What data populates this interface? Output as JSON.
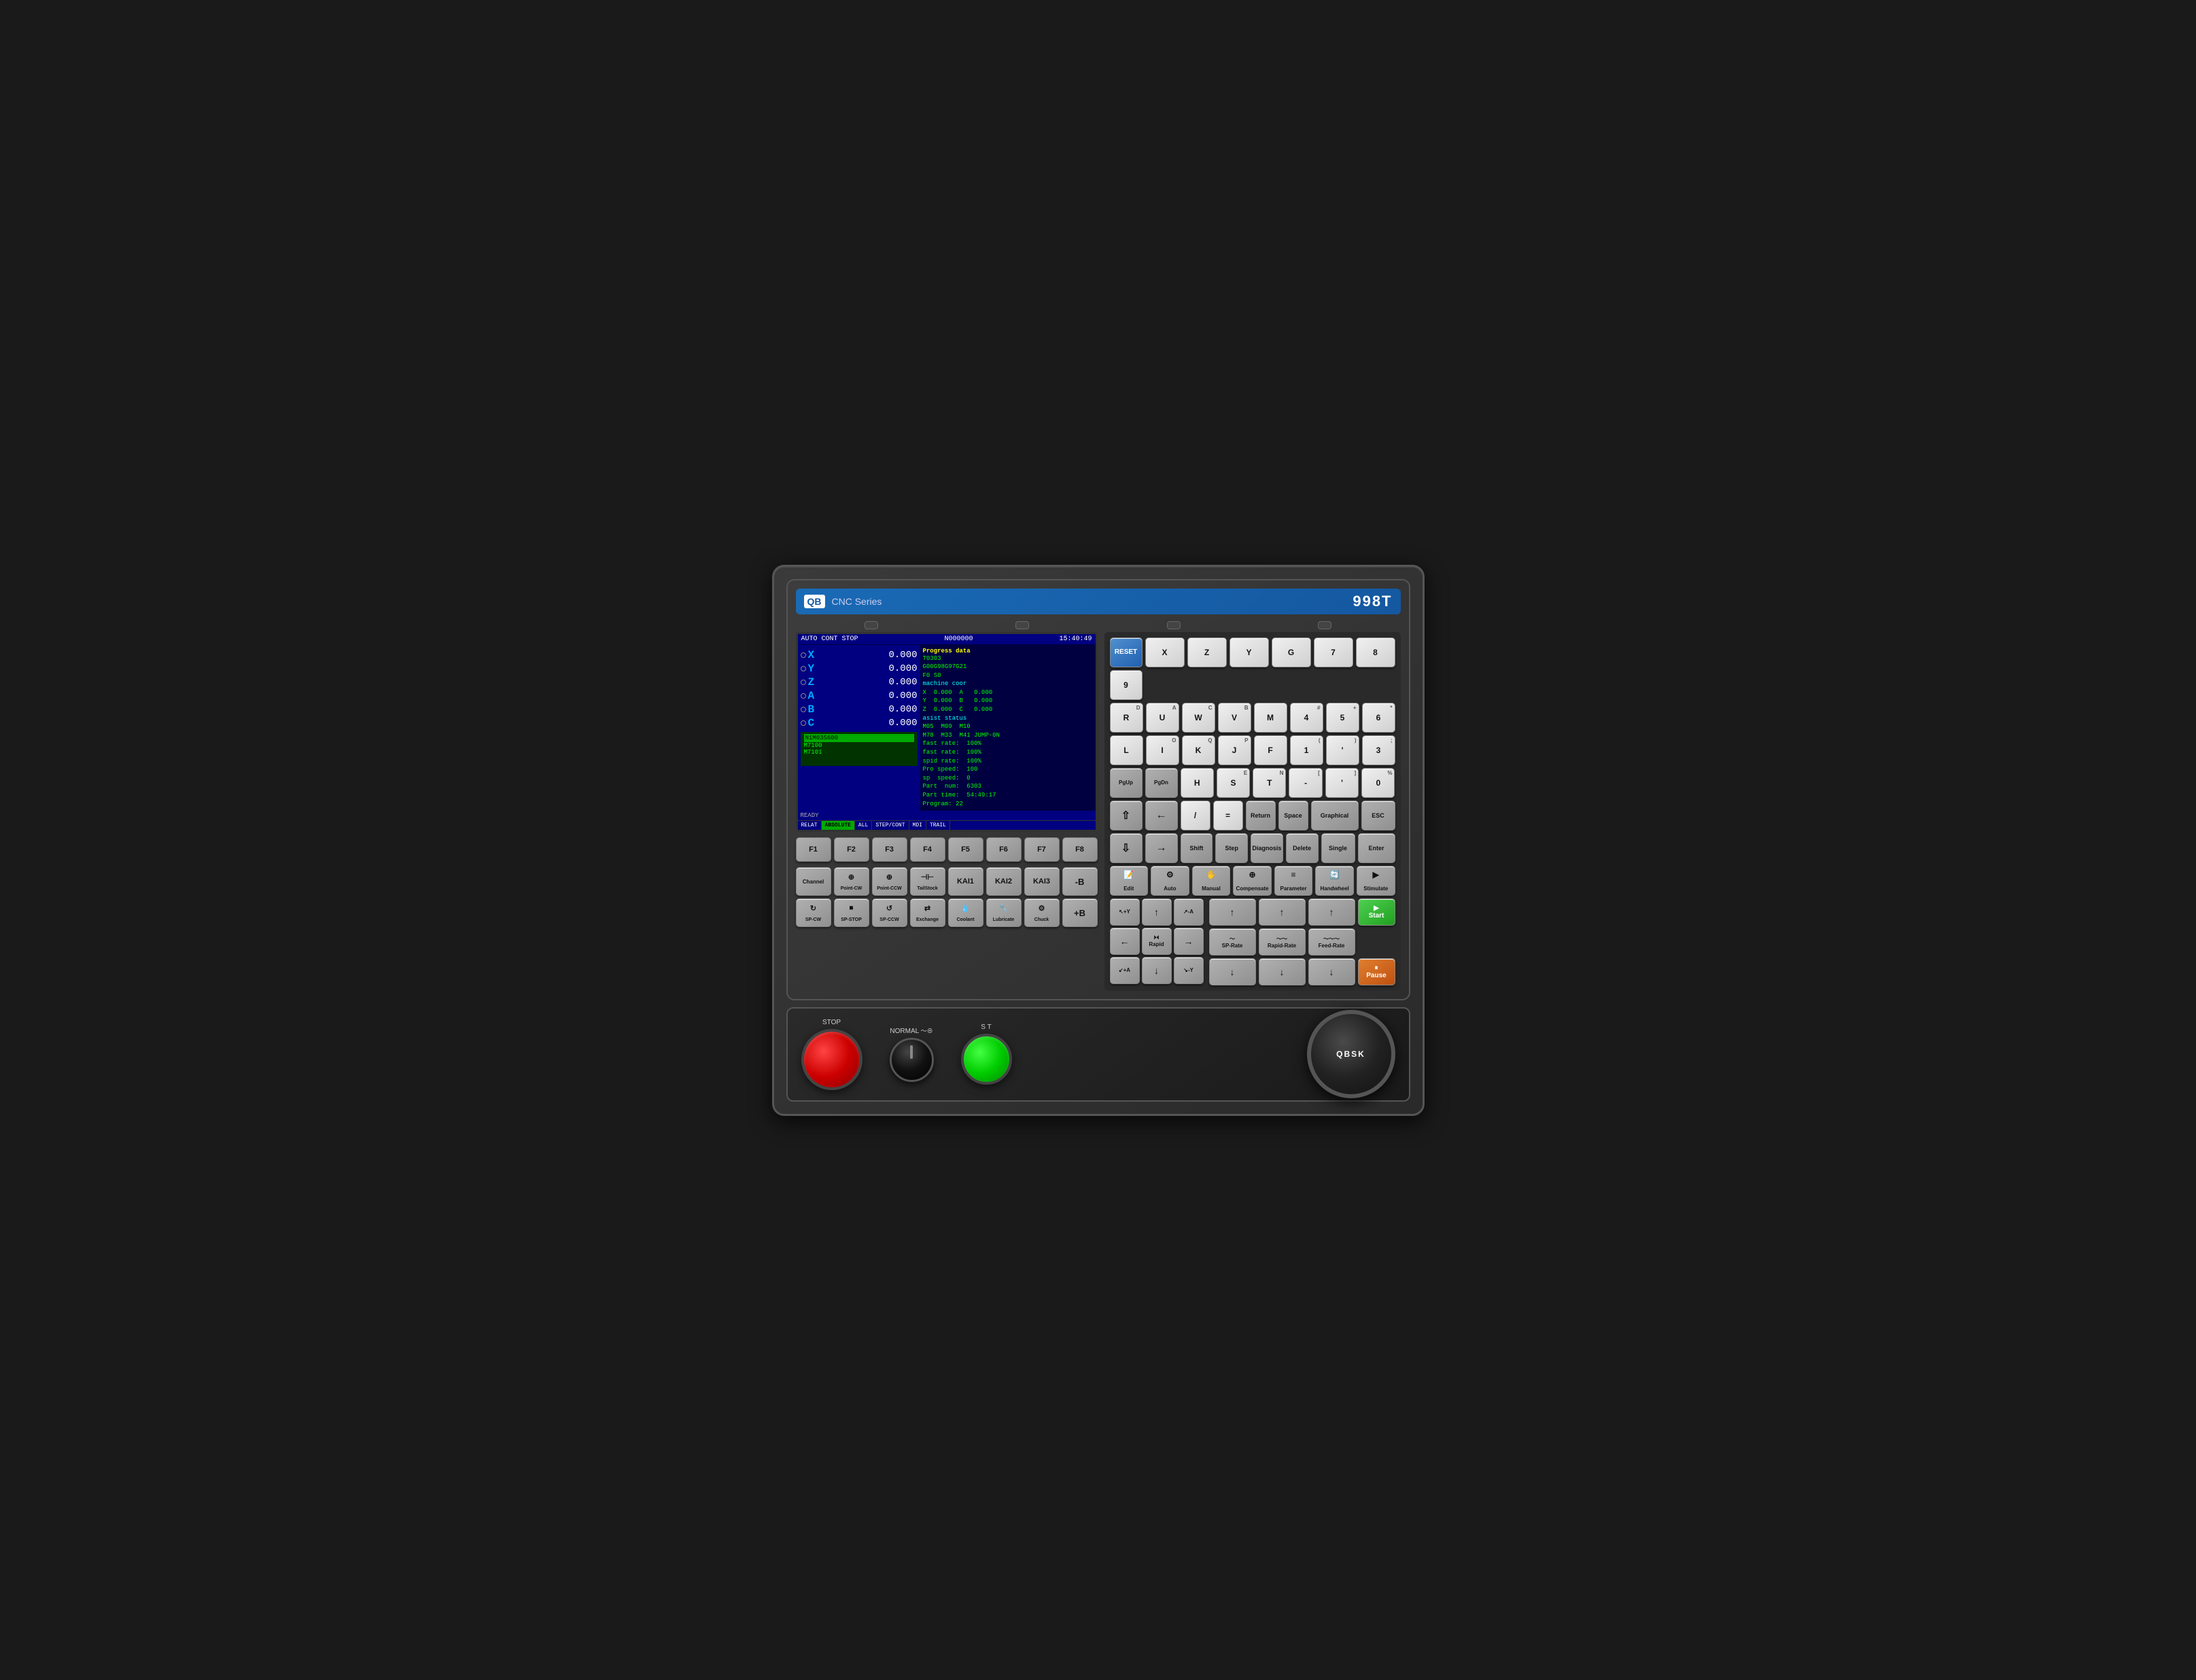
{
  "header": {
    "logo": "QB",
    "series": "CNC Series",
    "model": "998T"
  },
  "screen": {
    "status": "AUTO  CONT  STOP",
    "program": "N000000",
    "time": "15:40:49",
    "axes": [
      {
        "label": "X",
        "value": "0.000"
      },
      {
        "label": "Y",
        "value": "0.000"
      },
      {
        "label": "Z",
        "value": "0.000"
      },
      {
        "label": "A",
        "value": "0.000"
      },
      {
        "label": "B",
        "value": "0.000"
      },
      {
        "label": "C",
        "value": "0.000"
      }
    ],
    "progress": {
      "title": "Progress data",
      "lines": [
        "T0303",
        "G00G98G97G21",
        "F0  S0",
        "machine coor",
        "X    0.000   A    0.000",
        "Y    0.000   B    0.000",
        "Z    0.000   C    0.000",
        "asist status",
        "M05   M09   M10",
        "M78   M33   M41 JUMP-0N",
        "fast rate:  100%",
        "fast rate:  100%",
        "spid rate:  100%",
        "Pro speed:  100",
        "sp  speed:  0",
        "Part  num:  6303",
        "Part time:  54:49:17",
        "Program: 22"
      ]
    },
    "program_lines": [
      "N1M03S600",
      "M7100",
      "M7101"
    ],
    "ready": "READY",
    "tabs": [
      "RELAT",
      "ABSOLUTE",
      "ALL",
      "STEP/CONT",
      "MDI",
      "TRAIL",
      "",
      ""
    ]
  },
  "fkeys": [
    "F1",
    "F2",
    "F3",
    "F4",
    "F5",
    "F6",
    "F7",
    "F8"
  ],
  "keyboard": {
    "row1": {
      "reset": "RESET",
      "keys": [
        "X",
        "Z",
        "Y",
        "G",
        "7",
        "8",
        "9"
      ]
    },
    "row2": {
      "keys": [
        {
          "label": "R",
          "super": "D"
        },
        {
          "label": "U",
          "super": "A"
        },
        {
          "label": "W",
          "super": "C"
        },
        {
          "label": "V",
          "super": "B"
        },
        {
          "label": "M",
          "super": ""
        },
        {
          "label": "4",
          "super": "#"
        },
        {
          "label": "5",
          "super": "+"
        },
        {
          "label": "6",
          "super": "*"
        }
      ]
    },
    "row3": {
      "keys": [
        {
          "label": "L",
          "super": ""
        },
        {
          "label": "I",
          "super": "O"
        },
        {
          "label": "K",
          "super": "Q"
        },
        {
          "label": "J",
          "super": "P"
        },
        {
          "label": "F",
          "super": ""
        },
        {
          "label": "1",
          "super": "("
        },
        {
          "label": "'",
          "super": ")"
        },
        {
          "label": "3",
          "super": ":"
        }
      ]
    },
    "row4": {
      "pgup": "PgUp",
      "pgdn": "PgDn",
      "keys": [
        "H",
        "S",
        "E",
        "T",
        "N",
        "-",
        "[",
        "]",
        "0",
        "."
      ]
    },
    "row5": {
      "shift_up": "↑",
      "left": "←",
      "keys": [
        "/",
        "=",
        "Return",
        "Space",
        "Graphical",
        "ESC"
      ]
    },
    "row6": {
      "shift_dn": "↓",
      "right": "→",
      "keys": [
        "Shift",
        "Step",
        "Diagnosis",
        "Delete",
        "Single",
        "Enter"
      ]
    },
    "mode_row": {
      "keys": [
        "Edit",
        "Auto",
        "Manual",
        "Compensate",
        "Parameter",
        "Handwheel",
        "Stimulate"
      ]
    }
  },
  "bottom_controls": {
    "row1": [
      {
        "label": "Channel",
        "icon": ""
      },
      {
        "label": "Point-CW",
        "icon": "⊕"
      },
      {
        "label": "Point-CCW",
        "icon": "⊕"
      },
      {
        "label": "TailStock",
        "icon": ""
      },
      {
        "label": "KAI1",
        "icon": ""
      },
      {
        "label": "KAI2",
        "icon": ""
      },
      {
        "label": "KAI3",
        "icon": ""
      },
      {
        "label": "-B",
        "icon": ""
      }
    ],
    "row2": [
      {
        "label": "SP-CW",
        "icon": ""
      },
      {
        "label": "SP-STOP",
        "icon": ""
      },
      {
        "label": "SP-CCW",
        "icon": ""
      },
      {
        "label": "Exchange",
        "icon": ""
      },
      {
        "label": "Coolant",
        "icon": ""
      },
      {
        "label": "Lubricate",
        "icon": ""
      },
      {
        "label": "Chuck",
        "icon": ""
      },
      {
        "label": "+B",
        "icon": ""
      }
    ]
  },
  "jog": {
    "grid": [
      [
        "+Y▲",
        "↗-A",
        ""
      ],
      [
        "←",
        "Rapid",
        "→"
      ],
      [
        "+A↙",
        "↓-Y",
        ""
      ]
    ],
    "rates": [
      "SP-Rate",
      "Rapid-Rate",
      "Feed-Rate"
    ],
    "up_buttons": [
      "↑",
      "↑",
      "↑"
    ],
    "down_buttons": [
      "↓",
      "↓",
      "↓"
    ]
  },
  "bottom_panel": {
    "stop_label": "STOP",
    "normal_label": "NORMAL",
    "st_label": "S T",
    "qbsk_label": "QBSK"
  }
}
